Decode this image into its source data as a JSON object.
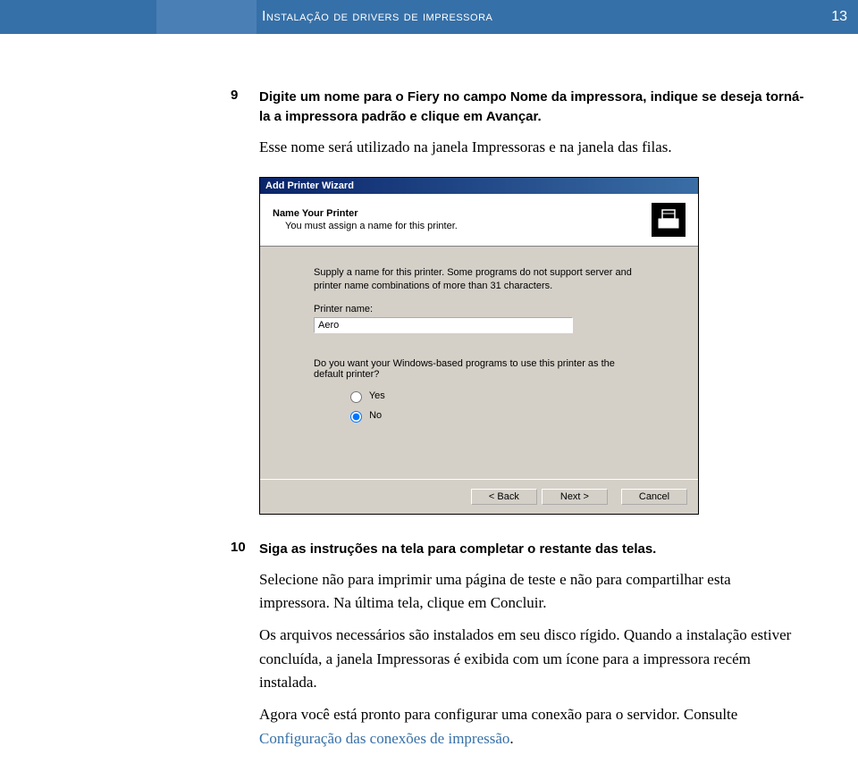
{
  "header": {
    "title": "Instalação de drivers de impressora",
    "page": "13"
  },
  "step9": {
    "num": "9",
    "bold": "Digite um nome para o Fiery no campo Nome da impressora, indique se deseja torná-la a impressora padrão e clique em Avançar.",
    "body": "Esse nome será utilizado na janela Impressoras e na janela das filas."
  },
  "wizard": {
    "titlebar": "Add Printer Wizard",
    "head_title": "Name Your Printer",
    "head_sub": "You must assign a name for this printer.",
    "supply": "Supply a name for this printer. Some programs do not support server and printer name combinations of more than 31 characters.",
    "pname_label": "Printer name:",
    "pname_value": "Aero",
    "question": "Do you want your Windows-based programs to use this printer as the default printer?",
    "yes": "Yes",
    "no": "No",
    "back": "< Back",
    "next": "Next >",
    "cancel": "Cancel"
  },
  "step10": {
    "num": "10",
    "bold": "Siga as instruções na tela para completar o restante das telas.",
    "p1": "Selecione não para imprimir uma página de teste e não para compartilhar esta impressora. Na última tela, clique em Concluir.",
    "p2a": "Os arquivos necessários são instalados em seu disco rígido. Quando a instalação estiver concluída, a janela Impressoras é exibida com um ícone para a impressora recém instalada.",
    "p3a": "Agora você está pronto para configurar uma conexão para o servidor. Consulte ",
    "p3link": "Configuração das conexões de impressão",
    "p3b": "."
  }
}
